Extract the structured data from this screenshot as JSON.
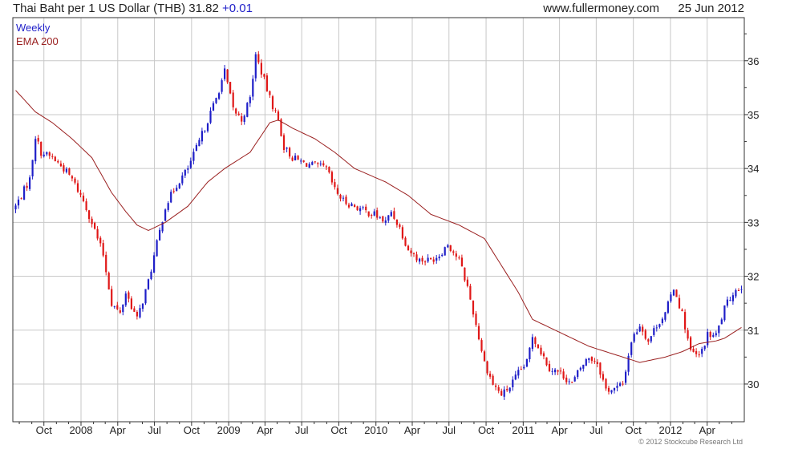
{
  "header": {
    "title": "Thai Baht per 1 US Dollar (THB)",
    "last": "31.82",
    "change": "+0.01",
    "site": "www.fullermoney.com",
    "date": "25 Jun 2012"
  },
  "footer": {
    "copyright": "© 2012 Stockcube Research Ltd"
  },
  "colors": {
    "up": "#1f1fc8",
    "down": "#e01818",
    "ema": "#9a2020",
    "grid": "#c8c8c8",
    "frame": "#333333"
  },
  "chart_data": {
    "type": "candlestick",
    "legend": [
      {
        "name": "Weekly",
        "color": "#1f1fc8"
      },
      {
        "name": "EMA 200",
        "color": "#9a2020"
      }
    ],
    "x_ticks": [
      "Oct",
      "2008",
      "Apr",
      "Jul",
      "Oct",
      "2009",
      "Apr",
      "Jul",
      "Oct",
      "2010",
      "Apr",
      "Jul",
      "Oct",
      "2011",
      "Apr",
      "Jul",
      "Oct",
      "2012",
      "Apr"
    ],
    "y_ticks": [
      "30",
      "31",
      "32",
      "33",
      "34",
      "35",
      "36"
    ],
    "ylim": [
      29.3,
      36.8
    ],
    "grid": true,
    "y_axis_side": "right",
    "close_path": [
      [
        "2007-07-23",
        33.3
      ],
      [
        "2007-08-27",
        33.8
      ],
      [
        "2007-09-10",
        34.6
      ],
      [
        "2007-09-24",
        34.3
      ],
      [
        "2007-10-22",
        34.2
      ],
      [
        "2007-11-19",
        34.0
      ],
      [
        "2007-12-10",
        33.8
      ],
      [
        "2008-01-07",
        33.4
      ],
      [
        "2008-01-28",
        33.0
      ],
      [
        "2008-02-25",
        32.4
      ],
      [
        "2008-03-17",
        31.5
      ],
      [
        "2008-04-07",
        31.3
      ],
      [
        "2008-04-21",
        31.7
      ],
      [
        "2008-05-19",
        31.2
      ],
      [
        "2008-06-16",
        31.9
      ],
      [
        "2008-07-07",
        32.6
      ],
      [
        "2008-07-28",
        33.3
      ],
      [
        "2008-08-25",
        33.7
      ],
      [
        "2008-09-22",
        34.0
      ],
      [
        "2008-10-20",
        34.5
      ],
      [
        "2008-11-10",
        34.9
      ],
      [
        "2008-12-01",
        35.3
      ],
      [
        "2008-12-22",
        35.8
      ],
      [
        "2009-01-12",
        35.1
      ],
      [
        "2009-02-02",
        34.9
      ],
      [
        "2009-02-23",
        35.3
      ],
      [
        "2009-03-09",
        36.1
      ],
      [
        "2009-03-23",
        35.8
      ],
      [
        "2009-04-13",
        35.3
      ],
      [
        "2009-05-04",
        34.9
      ],
      [
        "2009-05-18",
        34.4
      ],
      [
        "2009-06-08",
        34.2
      ],
      [
        "2009-07-06",
        34.1
      ],
      [
        "2009-08-03",
        34.05
      ],
      [
        "2009-08-31",
        34.0
      ],
      [
        "2009-09-21",
        33.6
      ],
      [
        "2009-10-12",
        33.4
      ],
      [
        "2009-11-09",
        33.3
      ],
      [
        "2009-12-07",
        33.2
      ],
      [
        "2009-12-28",
        33.15
      ],
      [
        "2010-01-25",
        33.0
      ],
      [
        "2010-02-08",
        33.2
      ],
      [
        "2010-03-01",
        32.9
      ],
      [
        "2010-03-22",
        32.5
      ],
      [
        "2010-04-19",
        32.3
      ],
      [
        "2010-05-17",
        32.3
      ],
      [
        "2010-06-07",
        32.4
      ],
      [
        "2010-06-28",
        32.6
      ],
      [
        "2010-07-26",
        32.3
      ],
      [
        "2010-08-16",
        31.8
      ],
      [
        "2010-09-06",
        31.1
      ],
      [
        "2010-09-27",
        30.4
      ],
      [
        "2010-10-18",
        30.0
      ],
      [
        "2010-11-08",
        29.8
      ],
      [
        "2010-11-29",
        29.95
      ],
      [
        "2010-12-20",
        30.2
      ],
      [
        "2011-01-10",
        30.4
      ],
      [
        "2011-01-24",
        30.9
      ],
      [
        "2011-02-14",
        30.6
      ],
      [
        "2011-03-07",
        30.3
      ],
      [
        "2011-04-04",
        30.2
      ],
      [
        "2011-05-02",
        30.0
      ],
      [
        "2011-05-23",
        30.3
      ],
      [
        "2011-06-13",
        30.5
      ],
      [
        "2011-07-04",
        30.4
      ],
      [
        "2011-07-25",
        29.9
      ],
      [
        "2011-08-15",
        29.9
      ],
      [
        "2011-09-05",
        30.0
      ],
      [
        "2011-09-26",
        30.8
      ],
      [
        "2011-10-17",
        31.1
      ],
      [
        "2011-11-07",
        30.8
      ],
      [
        "2011-11-28",
        31.1
      ],
      [
        "2011-12-19",
        31.3
      ],
      [
        "2012-01-09",
        31.8
      ],
      [
        "2012-01-30",
        31.3
      ],
      [
        "2012-02-20",
        30.6
      ],
      [
        "2012-03-12",
        30.5
      ],
      [
        "2012-04-02",
        30.9
      ],
      [
        "2012-04-23",
        30.9
      ],
      [
        "2012-05-14",
        31.4
      ],
      [
        "2012-06-04",
        31.7
      ],
      [
        "2012-06-25",
        31.82
      ]
    ],
    "ema_path": [
      [
        "2007-07-23",
        35.45
      ],
      [
        "2007-09-10",
        35.05
      ],
      [
        "2007-10-22",
        34.85
      ],
      [
        "2007-12-10",
        34.55
      ],
      [
        "2008-01-28",
        34.2
      ],
      [
        "2008-03-17",
        33.55
      ],
      [
        "2008-04-21",
        33.2
      ],
      [
        "2008-05-19",
        32.95
      ],
      [
        "2008-06-16",
        32.85
      ],
      [
        "2008-07-28",
        33.0
      ],
      [
        "2008-09-22",
        33.3
      ],
      [
        "2008-11-10",
        33.75
      ],
      [
        "2008-12-22",
        34.0
      ],
      [
        "2009-02-23",
        34.3
      ],
      [
        "2009-04-13",
        34.85
      ],
      [
        "2009-05-04",
        34.9
      ],
      [
        "2009-06-08",
        34.75
      ],
      [
        "2009-08-03",
        34.55
      ],
      [
        "2009-09-21",
        34.3
      ],
      [
        "2009-11-09",
        34.0
      ],
      [
        "2010-01-25",
        33.75
      ],
      [
        "2010-03-22",
        33.5
      ],
      [
        "2010-05-17",
        33.15
      ],
      [
        "2010-07-26",
        32.95
      ],
      [
        "2010-09-27",
        32.7
      ],
      [
        "2010-11-08",
        32.2
      ],
      [
        "2010-12-20",
        31.7
      ],
      [
        "2011-01-24",
        31.2
      ],
      [
        "2011-04-04",
        30.95
      ],
      [
        "2011-06-13",
        30.7
      ],
      [
        "2011-08-15",
        30.55
      ],
      [
        "2011-10-17",
        30.4
      ],
      [
        "2011-12-19",
        30.5
      ],
      [
        "2012-01-30",
        30.6
      ],
      [
        "2012-03-12",
        30.75
      ],
      [
        "2012-04-23",
        30.8
      ],
      [
        "2012-05-14",
        30.85
      ],
      [
        "2012-06-25",
        31.05
      ]
    ]
  }
}
